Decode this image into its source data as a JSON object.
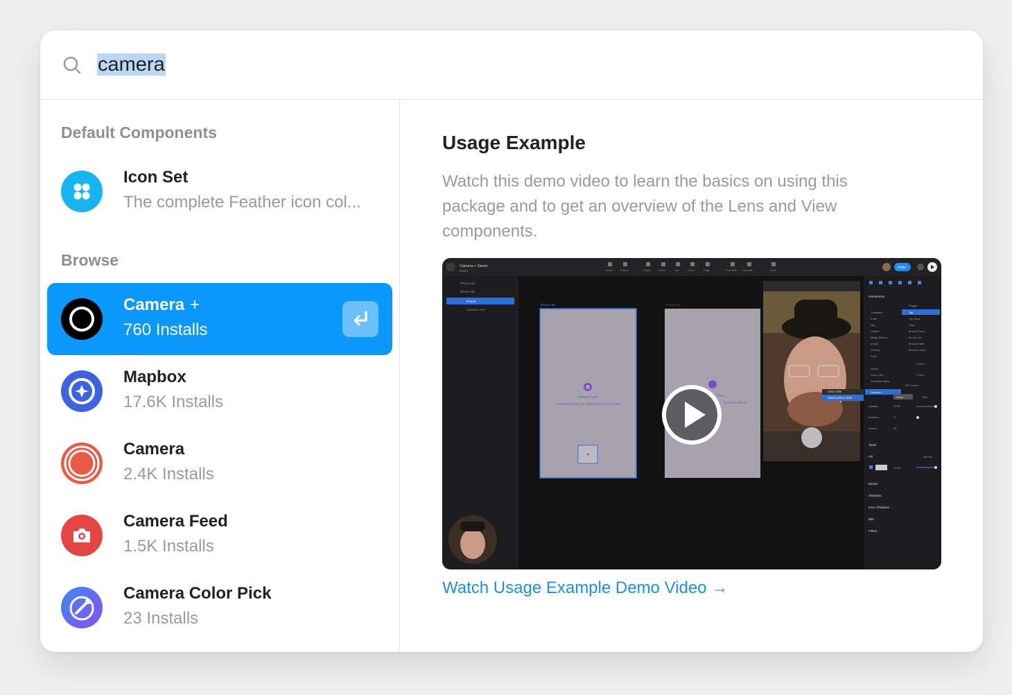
{
  "search": {
    "query": "camera"
  },
  "left": {
    "default_section": "Default Components",
    "browse_section": "Browse",
    "default_items": [
      {
        "name": "Icon Set",
        "subtitle": "The complete Feather icon col...",
        "icon": "grid-dots-icon",
        "color": "#18b4f2"
      }
    ],
    "browse_items": [
      {
        "name": "Camera",
        "plus": "+",
        "subtitle": "760 Installs",
        "icon": "camera-ring-icon",
        "color": "#000000",
        "selected": true
      },
      {
        "name": "Mapbox",
        "subtitle": "17.6K Installs",
        "icon": "map-compass-icon",
        "color": "#3d63e0"
      },
      {
        "name": "Camera",
        "subtitle": "2.4K Installs",
        "icon": "camera-ring-icon",
        "color": "#ea5a45"
      },
      {
        "name": "Camera Feed",
        "subtitle": "1.5K Installs",
        "icon": "camera-icon",
        "color": "#e74444"
      },
      {
        "name": "Camera Color Pick",
        "subtitle": "23 Installs",
        "icon": "color-picker-icon",
        "color": "#6f5ff0"
      }
    ]
  },
  "right": {
    "title": "Usage Example",
    "description": "Watch this demo video to learn the basics on using this package and to get an overview of the Lens and View components.",
    "link": "Watch Usage Example Demo Video →"
  },
  "video": {
    "app_title": "Camera + Demo",
    "app_sub": "Drafts",
    "tools": [
      "Insert",
      "Import",
      "Frame",
      "Stack",
      "Text",
      "Scroll",
      "Page",
      "Comment",
      "Handoff",
      "100%"
    ],
    "invite": "Invite",
    "layers": [
      "iPhone SE",
      "iPhone SE",
      "Round",
      "Camera Lens"
    ],
    "frame1_label": "iPhone SE",
    "frame2_label": "iPhone SE",
    "lens_title": "Camera Lens",
    "lens_desc": "Connect and view your camera lens in the preview",
    "view_title": "View",
    "view_desc": "send lens data to",
    "context_menu": [
      "Clear View",
      "Send Lens to View"
    ],
    "panel_sections": [
      "Interactions",
      "Stack",
      "Fill",
      "Border",
      "Shadows",
      "Inner Shadows",
      "Blur",
      "Filters"
    ],
    "panel_rows": [
      "Transition",
      "Fade",
      "Flip",
      "Instant",
      "Magic Motion",
      "Modal",
      "Overlay",
      "Push",
      "Action",
      "Open Link",
      "Transition Back",
      "Opacity",
      "Rotation",
      "Radius"
    ],
    "triggers": [
      "Trigger",
      "Tap",
      "Tap Start",
      "Click",
      "Mouse Down",
      "Mouse Up",
      "Mouse Enter",
      "Mouse Leave"
    ],
    "panel_values": [
      "Fixed",
      "Fixed",
      "Fit Content",
      "Camera +",
      "Show",
      "Hide",
      "100%",
      "0°",
      "35",
      "Normal",
      "100%"
    ]
  }
}
